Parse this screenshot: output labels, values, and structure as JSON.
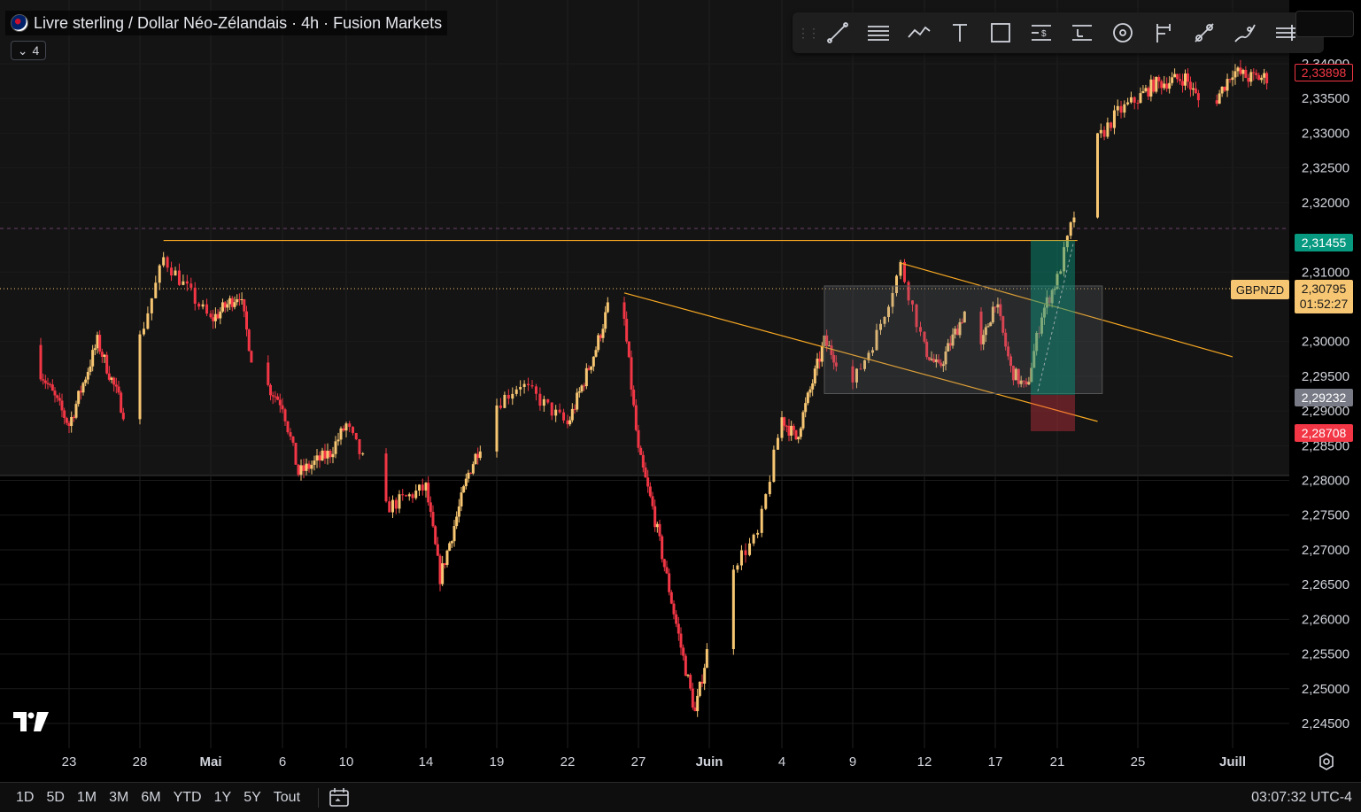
{
  "header": {
    "symbol_title": "Livre sterling / Dollar Néo-Zélandais · 4h · Fusion Markets",
    "indicators_count": "4"
  },
  "toolbar": {
    "tools": [
      "trend-line-icon",
      "fib-retracement-icon",
      "path-icon",
      "text-icon",
      "rectangle-icon",
      "price-range-icon",
      "long-position-icon",
      "target-icon",
      "projection-icon",
      "price-note-icon",
      "brush-icon",
      "more-tools-icon"
    ]
  },
  "price_axis": {
    "ticks": [
      "2,34000",
      "2,33500",
      "2,33000",
      "2,32500",
      "2,32000",
      "2,31000",
      "2,30000",
      "2,29500",
      "2,29000",
      "2,28500",
      "2,28000",
      "2,27500",
      "2,27000",
      "2,26500",
      "2,26000",
      "2,25500",
      "2,25000",
      "2,24500"
    ],
    "labels": {
      "top_red": "2,33898",
      "target_green": "2,31455",
      "current_symbol": "GBPNZD",
      "current_price": "2,30795",
      "countdown": "01:52:27",
      "entry_gray": "2,29232",
      "stop_red": "2,28708"
    }
  },
  "time_axis": {
    "ticks": [
      "23",
      "28",
      "Mai",
      "6",
      "10",
      "14",
      "19",
      "22",
      "27",
      "Juin",
      "4",
      "9",
      "12",
      "17",
      "21",
      "25",
      "Juill"
    ]
  },
  "bottom_bar": {
    "ranges": [
      "1D",
      "5D",
      "1M",
      "3M",
      "6M",
      "YTD",
      "1Y",
      "5Y",
      "Tout"
    ],
    "clock": "03:07:32 UTC-4"
  },
  "colors": {
    "up": "#f7c672",
    "down": "#f23645",
    "line": "#f7a823",
    "green": "#089981",
    "red": "#f23645"
  },
  "chart_data": {
    "type": "candlestick",
    "symbol": "GBPNZD",
    "timeframe": "4h",
    "ylim": [
      2.2435,
      2.3412
    ],
    "path_anchors": [
      {
        "x": "Apr 20",
        "y": 2.2995
      },
      {
        "x": "Apr 23",
        "y": 2.288
      },
      {
        "x": "Apr 25",
        "y": 2.3
      },
      {
        "x": "Apr 27",
        "y": 2.289
      },
      {
        "x": "Apr 29",
        "y": 2.312
      },
      {
        "x": "May 1",
        "y": 2.303
      },
      {
        "x": "May 3",
        "y": 2.307
      },
      {
        "x": "May 4",
        "y": 2.296
      },
      {
        "x": "May 6",
        "y": 2.291
      },
      {
        "x": "May 7",
        "y": 2.281
      },
      {
        "x": "May 9",
        "y": 2.284
      },
      {
        "x": "May 10",
        "y": 2.288
      },
      {
        "x": "May 12",
        "y": 2.276
      },
      {
        "x": "May 14",
        "y": 2.279
      },
      {
        "x": "May 15",
        "y": 2.266
      },
      {
        "x": "May 17",
        "y": 2.281
      },
      {
        "x": "May 19",
        "y": 2.291
      },
      {
        "x": "May 20",
        "y": 2.294
      },
      {
        "x": "May 22",
        "y": 2.288
      },
      {
        "x": "May 24",
        "y": 2.299
      },
      {
        "x": "May 25",
        "y": 2.306
      },
      {
        "x": "May 26",
        "y": 2.303
      },
      {
        "x": "May 27",
        "y": 2.284
      },
      {
        "x": "May 28",
        "y": 2.276
      },
      {
        "x": "May 29",
        "y": 2.266
      },
      {
        "x": "May 30",
        "y": 2.256
      },
      {
        "x": "May 31",
        "y": 2.2465
      },
      {
        "x": "Jun 1",
        "y": 2.257
      },
      {
        "x": "Jun 2",
        "y": 2.268
      },
      {
        "x": "Jun 3",
        "y": 2.272
      },
      {
        "x": "Jun 4",
        "y": 2.289
      },
      {
        "x": "Jun 5",
        "y": 2.286
      },
      {
        "x": "Jun 7",
        "y": 2.3
      },
      {
        "x": "Jun 9",
        "y": 2.294
      },
      {
        "x": "Jun 10",
        "y": 2.301
      },
      {
        "x": "Jun 11",
        "y": 2.311
      },
      {
        "x": "Jun 12",
        "y": 2.299
      },
      {
        "x": "Jun 13",
        "y": 2.296
      },
      {
        "x": "Jun 15",
        "y": 2.305
      },
      {
        "x": "Jun 16",
        "y": 2.299
      },
      {
        "x": "Jun 17",
        "y": 2.306
      },
      {
        "x": "Jun 18",
        "y": 2.296
      },
      {
        "x": "Jun 19",
        "y": 2.293
      },
      {
        "x": "Jun 20",
        "y": 2.304
      },
      {
        "x": "Jun 21",
        "y": 2.309
      },
      {
        "x": "Jun 22",
        "y": 2.32
      },
      {
        "x": "Jun 23",
        "y": 2.329
      },
      {
        "x": "Jun 24",
        "y": 2.333
      },
      {
        "x": "Jun 26",
        "y": 2.337
      },
      {
        "x": "Jun 28",
        "y": 2.338
      },
      {
        "x": "Jun 29",
        "y": 2.334
      },
      {
        "x": "Jun 30",
        "y": 2.335
      },
      {
        "x": "Jul 1",
        "y": 2.339
      },
      {
        "x": "Jul 2",
        "y": 2.338
      }
    ],
    "drawings": {
      "resistance_line": {
        "from": "Apr 29",
        "to": "Jun 22",
        "price": 2.31455
      },
      "upper_trendline": {
        "from": [
          "Jun 11",
          2.3113
        ],
        "to": [
          "Jul 1",
          2.2978
        ]
      },
      "lower_trendline": {
        "from": [
          "May 26",
          2.307
        ],
        "to": [
          "Jun 23",
          2.2885
        ]
      },
      "range_box": {
        "from": "Jun 7",
        "to": "Jun 22",
        "high": 2.308,
        "low": 2.2925
      },
      "long_position": {
        "entry": 2.29232,
        "target": 2.31455,
        "stop": 2.28708
      }
    }
  }
}
